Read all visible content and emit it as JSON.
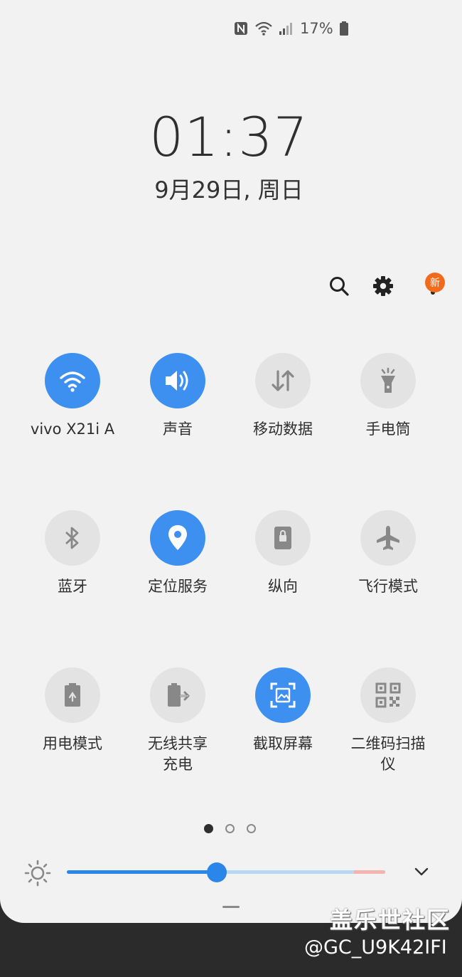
{
  "status_bar": {
    "battery_percent": "17%",
    "icons": [
      "nfc-icon",
      "wifi-icon",
      "signal-icon",
      "battery-icon"
    ]
  },
  "clock": {
    "time": "01:37",
    "date": "9月29日, 周日"
  },
  "header": {
    "badge": "新",
    "icons": [
      "search-icon",
      "gear-icon",
      "more-icon"
    ]
  },
  "tiles": [
    {
      "label": "vivo X21i A",
      "icon": "wifi-icon",
      "on": true
    },
    {
      "label": "声音",
      "icon": "sound-icon",
      "on": true
    },
    {
      "label": "移动数据",
      "icon": "mobile-data-icon",
      "on": false
    },
    {
      "label": "手电筒",
      "icon": "flashlight-icon",
      "on": false
    },
    {
      "label": "蓝牙",
      "icon": "bluetooth-icon",
      "on": false
    },
    {
      "label": "定位服务",
      "icon": "location-icon",
      "on": true
    },
    {
      "label": "纵向",
      "icon": "portrait-icon",
      "on": false
    },
    {
      "label": "飞行模式",
      "icon": "airplane-icon",
      "on": false
    },
    {
      "label": "用电模式",
      "icon": "power-mode-icon",
      "on": false
    },
    {
      "label": "无线共享\n充电",
      "icon": "wireless-share-icon",
      "on": false
    },
    {
      "label": "截取屏幕",
      "icon": "screenshot-icon",
      "on": true
    },
    {
      "label": "二维码扫描\n仪",
      "icon": "qr-code-icon",
      "on": false
    }
  ],
  "pager": {
    "pages": 3,
    "current": 1
  },
  "brightness": {
    "level": 0.47
  },
  "colors": {
    "accent": "#3d8ff0",
    "badge": "#f26b1d",
    "panel": "#f2f2f2"
  },
  "watermark": {
    "line1": "盖乐世社区",
    "line2": "@GC_U9K42IFI"
  }
}
